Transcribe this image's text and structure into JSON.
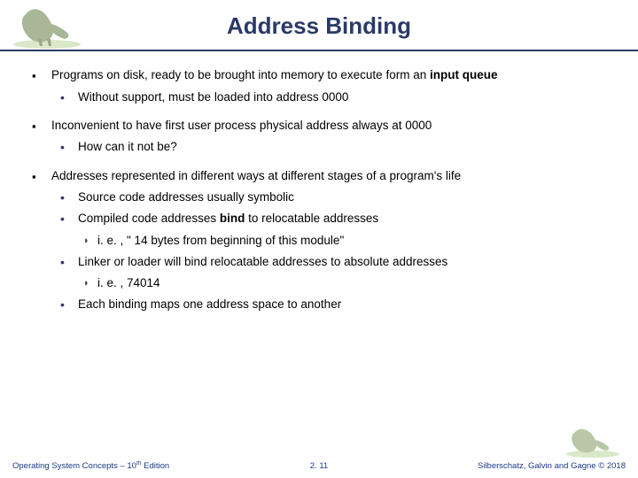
{
  "header": {
    "title": "Address Binding"
  },
  "bullets": {
    "p1_a": "Programs on disk, ready to be brought into memory to execute form an ",
    "p1_b": "input queue",
    "p1_sub1": "Without support, must be loaded into address 0000",
    "p2": "Inconvenient to have first user process physical address always at 0000",
    "p2_sub1": "How can it not be?",
    "p3": "Addresses represented in different ways at different stages of a program's life",
    "p3_sub1": "Source code addresses usually symbolic",
    "p3_sub2_a": "Compiled code addresses ",
    "p3_sub2_b": "bind",
    "p3_sub2_c": " to relocatable addresses",
    "p3_sub2_i": "i. e. , \" 14 bytes from beginning of this module\"",
    "p3_sub3": "Linker or loader will bind relocatable addresses to absolute addresses",
    "p3_sub3_i": "i. e. , 74014",
    "p3_sub4": "Each binding maps one address space to another"
  },
  "footer": {
    "left_a": "Operating System Concepts – 10",
    "left_b": " Edition",
    "left_sup": "th",
    "center": "2. 11",
    "right": "Silberschatz, Galvin and Gagne © 2018"
  }
}
